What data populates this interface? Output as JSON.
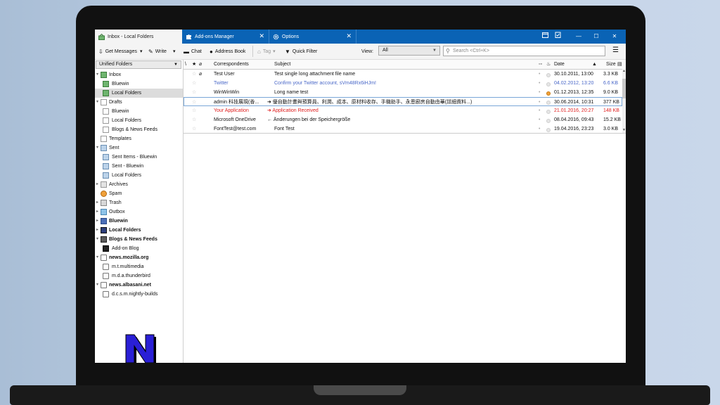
{
  "tabs": [
    {
      "label": "Inbox - Local Folders",
      "icon": "inbox-icon",
      "active": true
    },
    {
      "label": "Add-ons Manager",
      "icon": "puzzle-icon",
      "active": false
    },
    {
      "label": "Options",
      "icon": "gear-icon",
      "active": false
    }
  ],
  "toolbar": {
    "get_messages": "Get Messages",
    "write": "Write",
    "chat": "Chat",
    "address_book": "Address Book",
    "tag": "Tag",
    "quick_filter": "Quick Filter",
    "view_label": "View:",
    "view_value": "All",
    "search_placeholder": "Search <Ctrl+K>"
  },
  "folder_pane": {
    "header": "Unified Folders",
    "items": [
      {
        "label": "Inbox",
        "icon": "inbox-icon",
        "level": 0
      },
      {
        "label": "Bluewin",
        "icon": "inbox-icon",
        "level": 1
      },
      {
        "label": "Local Folders",
        "icon": "inbox-icon",
        "level": 1,
        "selected": true
      },
      {
        "label": "Drafts",
        "icon": "drafts-icon",
        "level": 0
      },
      {
        "label": "Bluewin",
        "icon": "page-icon",
        "level": 1
      },
      {
        "label": "Local Folders",
        "icon": "page-icon",
        "level": 1
      },
      {
        "label": "Blogs & News Feeds",
        "icon": "page-icon",
        "level": 1
      },
      {
        "label": "Templates",
        "icon": "templates-icon",
        "level": 0
      },
      {
        "label": "Sent",
        "icon": "sent-icon",
        "level": 0
      },
      {
        "label": "Sent Items - Bluewin",
        "icon": "sent-icon",
        "level": 1
      },
      {
        "label": "Sent - Bluewin",
        "icon": "sent-icon",
        "level": 1
      },
      {
        "label": "Local Folders",
        "icon": "sent-icon",
        "level": 1
      },
      {
        "label": "Archives",
        "icon": "archive-icon",
        "level": 0
      },
      {
        "label": "Spam",
        "icon": "spam-icon",
        "level": 0
      },
      {
        "label": "Trash",
        "icon": "trash-icon",
        "level": 0
      },
      {
        "label": "Outbox",
        "icon": "outbox-icon",
        "level": 0
      },
      {
        "label": "Bluewin",
        "icon": "server-icon",
        "level": 0,
        "bold": true
      },
      {
        "label": "Local Folders",
        "icon": "local-folders-icon",
        "level": 0,
        "bold": true
      },
      {
        "label": "Blogs & News Feeds",
        "icon": "rss-icon",
        "level": 0,
        "bold": true
      },
      {
        "label": "Add-on Blog",
        "icon": "blog-icon",
        "level": 1
      },
      {
        "label": "news.mozilla.org",
        "icon": "newsserver-icon",
        "level": 0,
        "bold": true
      },
      {
        "label": "m.t.multimedia",
        "icon": "newsgroup-icon",
        "level": 1
      },
      {
        "label": "m.d.a.thunderbird",
        "icon": "newsgroup-icon",
        "level": 1
      },
      {
        "label": "news.albasani.net",
        "icon": "newsserver-icon",
        "level": 0,
        "bold": true
      },
      {
        "label": "d.c.s.m.nightly-builds",
        "icon": "newsgroup-icon",
        "level": 1
      }
    ]
  },
  "thread_pane": {
    "columns": {
      "correspondents": "Correspondents",
      "subject": "Subject",
      "date": "Date",
      "size": "Size"
    },
    "messages": [
      {
        "correspondent": "Test User",
        "subject": "Test single long attachment file name",
        "date": "30.10.2011, 13:00",
        "size": "3.3 KB",
        "style": "normal",
        "attachment": true
      },
      {
        "correspondent": "Twitter",
        "subject": "Confirm your Twitter account, sVm48Rx6iHJm!",
        "date": "04.02.2012, 13:20",
        "size": "6.6 KB",
        "style": "unread-blue"
      },
      {
        "correspondent": "WinWinWin",
        "subject": "Long name test",
        "date": "01.12.2013, 12:35",
        "size": "9.0 KB",
        "style": "normal",
        "hot": true
      },
      {
        "correspondent": "admin 科技展現(香...",
        "subject": "➜ 優自動計畫與預算員、利潤、成本、原材料收存、手機助手、永恩廚房自動由華(詳細資料...)",
        "date": "30.06.2014, 10:31",
        "size": "377 KB",
        "style": "normal",
        "focused": true
      },
      {
        "correspondent": "Your Application",
        "subject": "➜ Application Received",
        "date": "21.01.2016, 20:27",
        "size": "148 KB",
        "style": "red"
      },
      {
        "correspondent": "Microsoft OneDrive",
        "subject": "← Änderungen bei der Speichergröße",
        "date": "08.04.2016, 09:43",
        "size": "15.2 KB",
        "style": "normal"
      },
      {
        "correspondent": "FontTest@test.com",
        "subject": "Font Test",
        "date": "19.04.2016, 23:23",
        "size": "3.0 KB",
        "style": "normal"
      }
    ]
  }
}
